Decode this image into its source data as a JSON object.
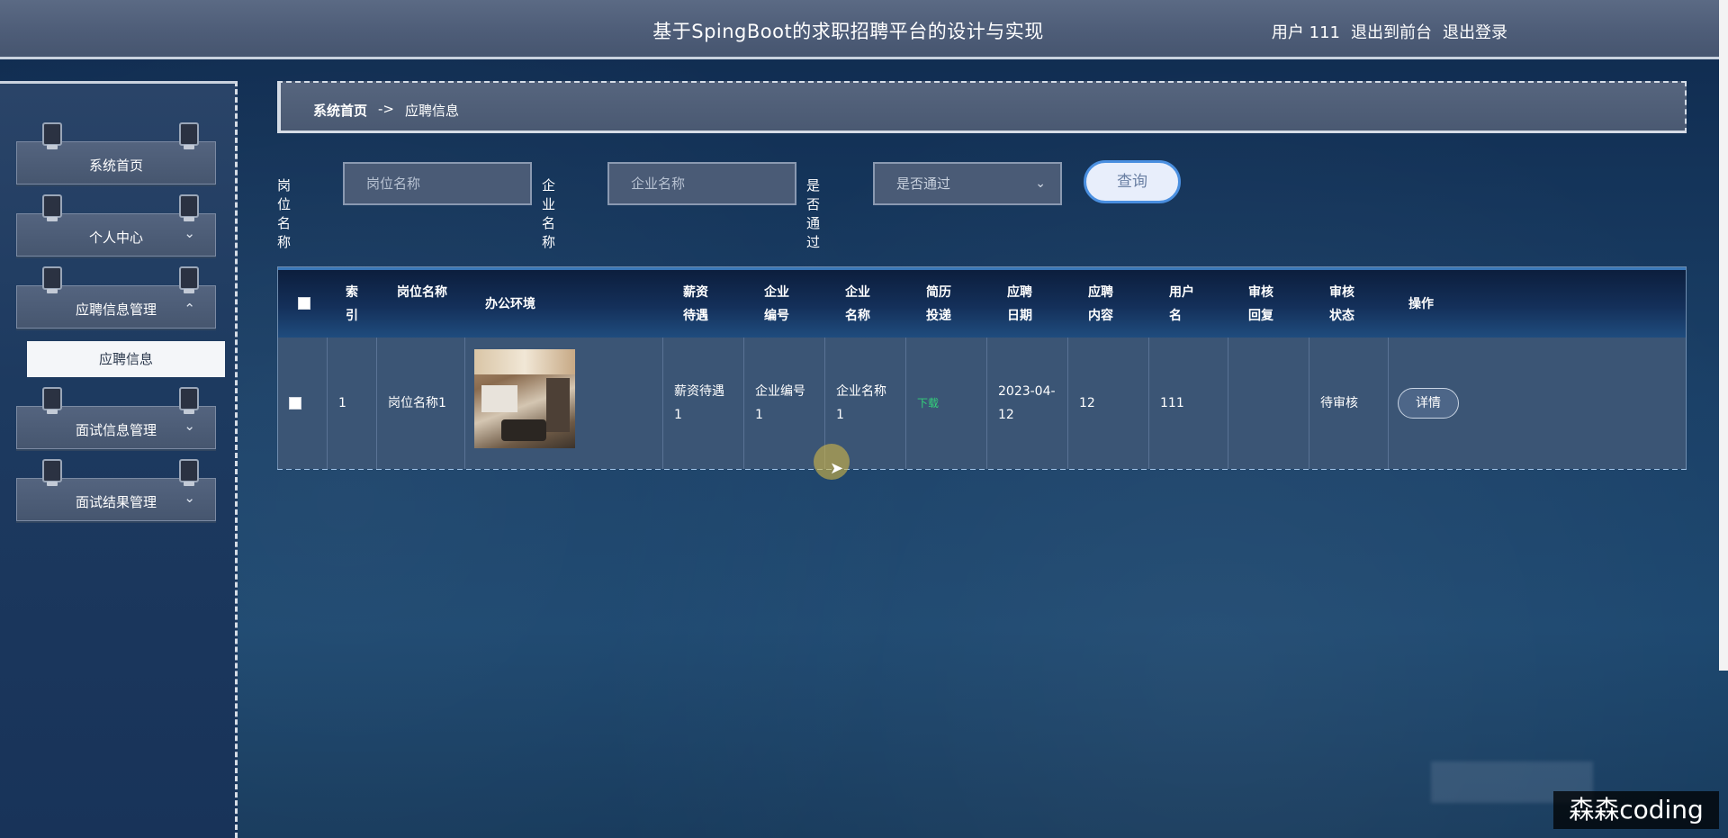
{
  "header": {
    "title": "基于SpingBoot的求职招聘平台的设计与实现",
    "user_label": "用户 111",
    "goto_front": "退出到前台",
    "logout": "退出登录"
  },
  "sidebar": {
    "items": [
      {
        "label": "系统首页",
        "has_chevron": false
      },
      {
        "label": "个人中心",
        "has_chevron": true
      },
      {
        "label": "应聘信息管理",
        "has_chevron": true,
        "expanded": true
      },
      {
        "label": "面试信息管理",
        "has_chevron": true
      },
      {
        "label": "面试结果管理",
        "has_chevron": true
      }
    ],
    "submenu_active": "应聘信息",
    "chevron_down": "⌄",
    "chevron_up": "⌃"
  },
  "breadcrumb": {
    "home": "系统首页",
    "separator": "->",
    "current": "应聘信息"
  },
  "search": {
    "job_label": "岗位名称",
    "job_placeholder": "岗位名称",
    "company_label": "企业名称",
    "company_placeholder": "企业名称",
    "pass_label": "是否通过",
    "pass_selected": "是否通过",
    "query_button": "查询"
  },
  "table": {
    "headers": {
      "index": "索引",
      "job_name": "岗位名称",
      "environment": "办公环境",
      "salary": "薪资待遇",
      "company_no": "企业编号",
      "company_name": "企业名称",
      "resume": "简历投递",
      "apply_date": "应聘日期",
      "apply_content": "应聘内容",
      "username": "用户名",
      "review_reply": "审核回复",
      "review_status": "审核状态",
      "actions": "操作"
    },
    "rows": [
      {
        "index": "1",
        "job_name": "岗位名称1",
        "salary": "薪资待遇1",
        "company_no": "企业编号1",
        "company_name": "企业名称1",
        "resume": "下载",
        "apply_date": "2023-04-12",
        "apply_content": "12",
        "username": "111",
        "review_reply": "",
        "review_status": "待审核",
        "detail_button": "详情"
      }
    ]
  },
  "watermark": "森森coding",
  "colors": {
    "accent_blue": "#4a8fe0",
    "download_green": "#33d17a",
    "header_bg": "#4e5d78"
  }
}
